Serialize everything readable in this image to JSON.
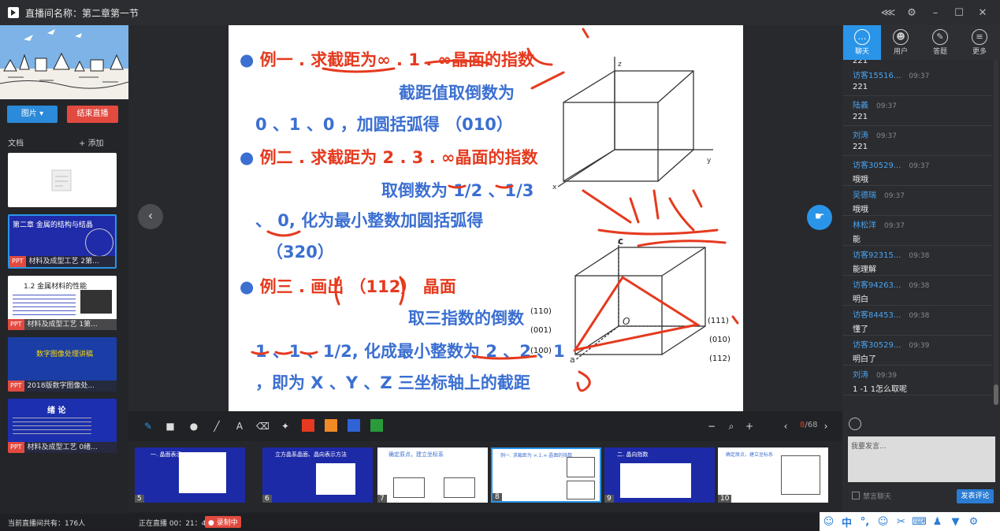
{
  "window": {
    "title": "直播间名称：第二章第一节"
  },
  "left_panel": {
    "picture_button": "图片 ▾",
    "end_live_button": "结束直播",
    "docs_label": "文档",
    "add_label": "+ 添加",
    "docs": [
      {
        "tag": "",
        "title": "",
        "slide_title": ""
      },
      {
        "tag": "PPT",
        "title": "材料及成型工艺 2第...",
        "slide_title": "第二章 金属的结构与结晶"
      },
      {
        "tag": "PPT",
        "title": "材料及成型工艺 1第...",
        "slide_title": "1.2 金属材料的性能"
      },
      {
        "tag": "PPT",
        "title": "2018版数字图像处...",
        "slide_title": "数字图像处理讲稿"
      },
      {
        "tag": "PPT",
        "title": "材料及成型工艺 0绪...",
        "slide_title": "绪 论"
      }
    ]
  },
  "slide": {
    "line1": "例一 . 求截距为∞ . 1 . ∞晶面的指数",
    "line2": "截距值取倒数为",
    "line3": "0 、1 、0 ，加圆括弧得 （010）",
    "line4": "例二 . 求截距为 2 . 3 . ∞晶面的指数",
    "line5": "取倒数为 1/2 、1/3",
    "line6": "、 0, 化为最小整数加圆括弧得",
    "line7": "（320）",
    "line8": "例三 . 画出 （112） 晶面",
    "line9": "取三指数的倒数",
    "line10": "1 、1 、1/2, 化成最小整数为 2 、2 、1",
    "line11": "，即为 X 、Y 、Z 三坐标轴上的截距",
    "axis_z": "z",
    "axis_y": "y",
    "axis_x": "x",
    "axis_c": "c",
    "origin": "O",
    "axis_a": "a",
    "plane_labels": [
      "(110)",
      "(001)",
      "(100)",
      "(111)",
      "(010)",
      "(112)"
    ]
  },
  "toolbar": {
    "page_current": "8",
    "page_total": "/68",
    "zoom_minus": "−",
    "zoom_plus": "+",
    "text_tool": "A"
  },
  "thumbnails": [
    {
      "num": "5",
      "heading": "一. 晶面表示"
    },
    {
      "num": "6",
      "heading": "立方晶系晶面、晶向表示方法"
    },
    {
      "num": "7",
      "heading": "确定原点，建立坐标系"
    },
    {
      "num": "8",
      "heading": "例一. 求截距为 ∞.1.∞ 晶面的指数"
    },
    {
      "num": "9",
      "heading": "二. 晶向指数"
    },
    {
      "num": "10",
      "heading": "确定原点，建立坐标系"
    }
  ],
  "chat": {
    "tabs": [
      "聊天",
      "用户",
      "答题",
      "更多"
    ],
    "partial_top": "221",
    "messages": [
      {
        "name": "访客15516...",
        "time": "09:37",
        "text": "221"
      },
      {
        "name": "陆義",
        "time": "09:37",
        "text": "221"
      },
      {
        "name": "刘涛",
        "time": "09:37",
        "text": "221"
      },
      {
        "name": "访客30529...",
        "time": "09:37",
        "text": "哦哦"
      },
      {
        "name": "吴德瑞",
        "time": "09:37",
        "text": "哦哦"
      },
      {
        "name": "林松洋",
        "time": "09:37",
        "text": "能"
      },
      {
        "name": "访客92315...",
        "time": "09:38",
        "text": "能理解"
      },
      {
        "name": "访客94263...",
        "time": "09:38",
        "text": "明白"
      },
      {
        "name": "访客84453...",
        "time": "09:38",
        "text": "懂了"
      },
      {
        "name": "访客30529...",
        "time": "09:39",
        "text": "明白了"
      },
      {
        "name": "刘涛",
        "time": "09:39",
        "text": "1 -1 1怎么取呢"
      }
    ],
    "input_placeholder": "我要发言...",
    "forbid_label": "禁言聊天",
    "send_label": "发表评论"
  },
  "status": {
    "online_count": "当前直播间共有：176人",
    "live_time": "正在直播 00：21：48",
    "recording": "录制中"
  },
  "colors": {
    "accent": "#2a95e8",
    "danger": "#e24a3f",
    "ink_red": "#e53a1f",
    "slide_blue": "#3b6fd1"
  }
}
